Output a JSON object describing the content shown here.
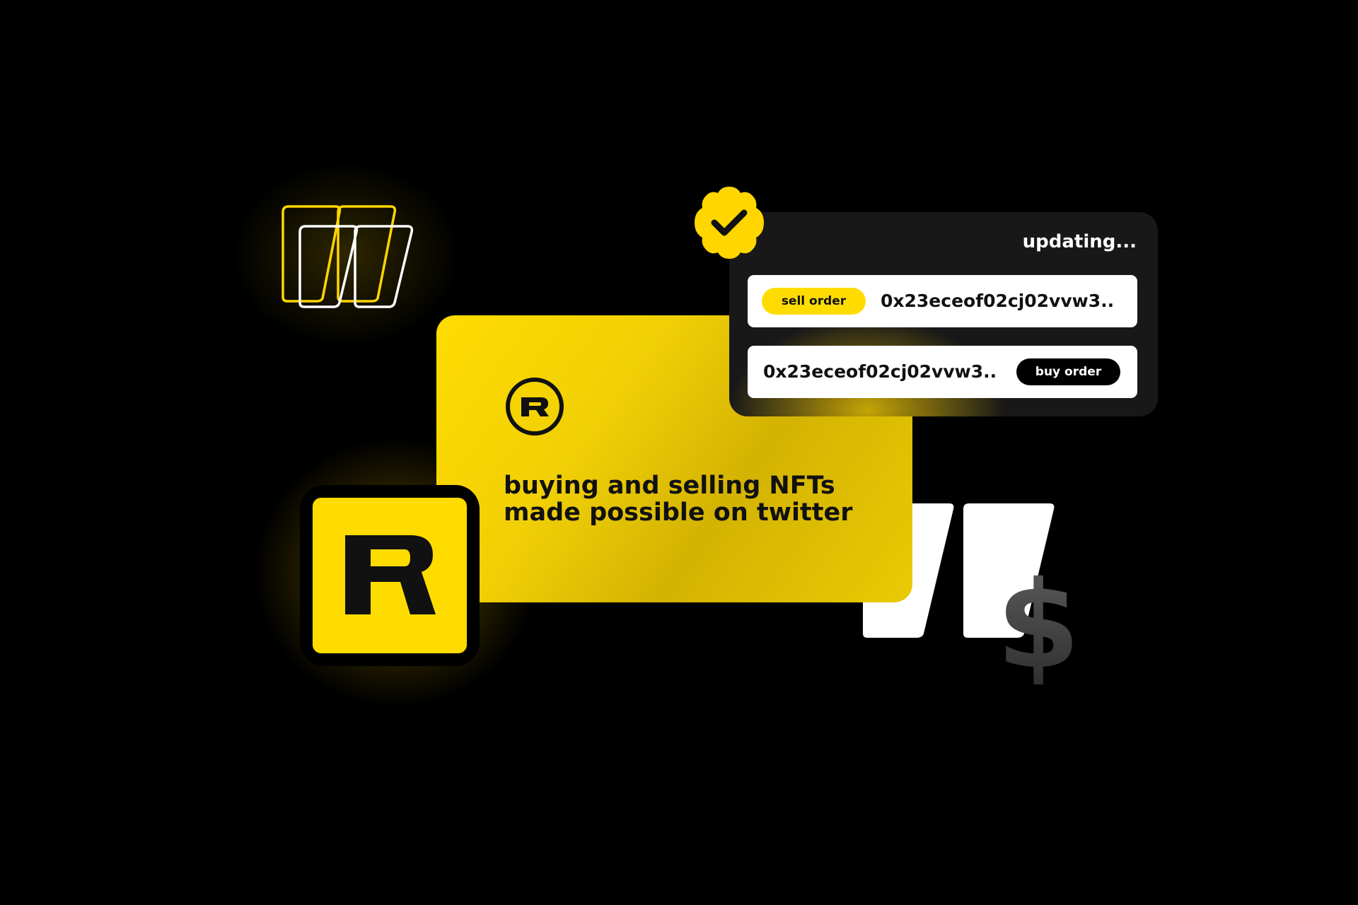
{
  "brand": {
    "accent": "#ffdc00",
    "background": "#000000",
    "panel": "#181818"
  },
  "main_card": {
    "logo_icon": "rarible-r-circle-icon",
    "headline_line1": "buying and selling NFTs",
    "headline_line2": "made possible on twitter"
  },
  "app_icon": {
    "icon": "rarible-r-app-icon"
  },
  "order_panel": {
    "status": "updating...",
    "orders": [
      {
        "type_label": "sell order",
        "hash": "0x23eceof02cj02vvw3.."
      },
      {
        "type_label": "buy order",
        "hash": "0x23eceof02cj02vvw3.."
      }
    ]
  },
  "badge": {
    "icon": "verified-check-icon"
  },
  "decorations": {
    "outline_quotes_icon": "quote-outline-icon",
    "solid_quotes_icon": "quote-solid-icon",
    "currency_symbol": "$"
  }
}
